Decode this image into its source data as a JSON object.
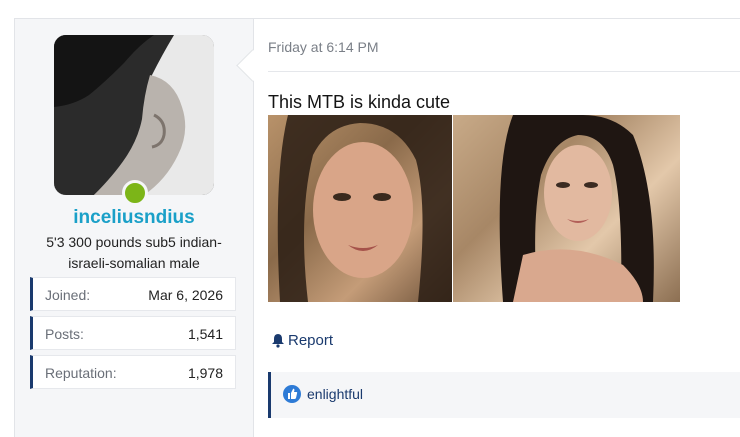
{
  "user": {
    "username": "inceliusndius",
    "title": "5'3 300 pounds sub5 indian-israeli-somalian male",
    "stats": [
      {
        "label": "Joined:",
        "value": "Mar 6, 2026"
      },
      {
        "label": "Posts:",
        "value": "1,541"
      },
      {
        "label": "Reputation:",
        "value": "1,978"
      }
    ],
    "online": true
  },
  "post": {
    "date": "Friday at 6:14 PM",
    "text": "This MTB is kinda cute",
    "report_label": "Report",
    "reaction_label": "enlightful"
  },
  "colors": {
    "username": "#1aa0c8",
    "accent": "#1a3a6e",
    "online": "#7cb518"
  },
  "icons": {
    "report": "bell-icon",
    "reaction": "thumbs-up-icon"
  }
}
